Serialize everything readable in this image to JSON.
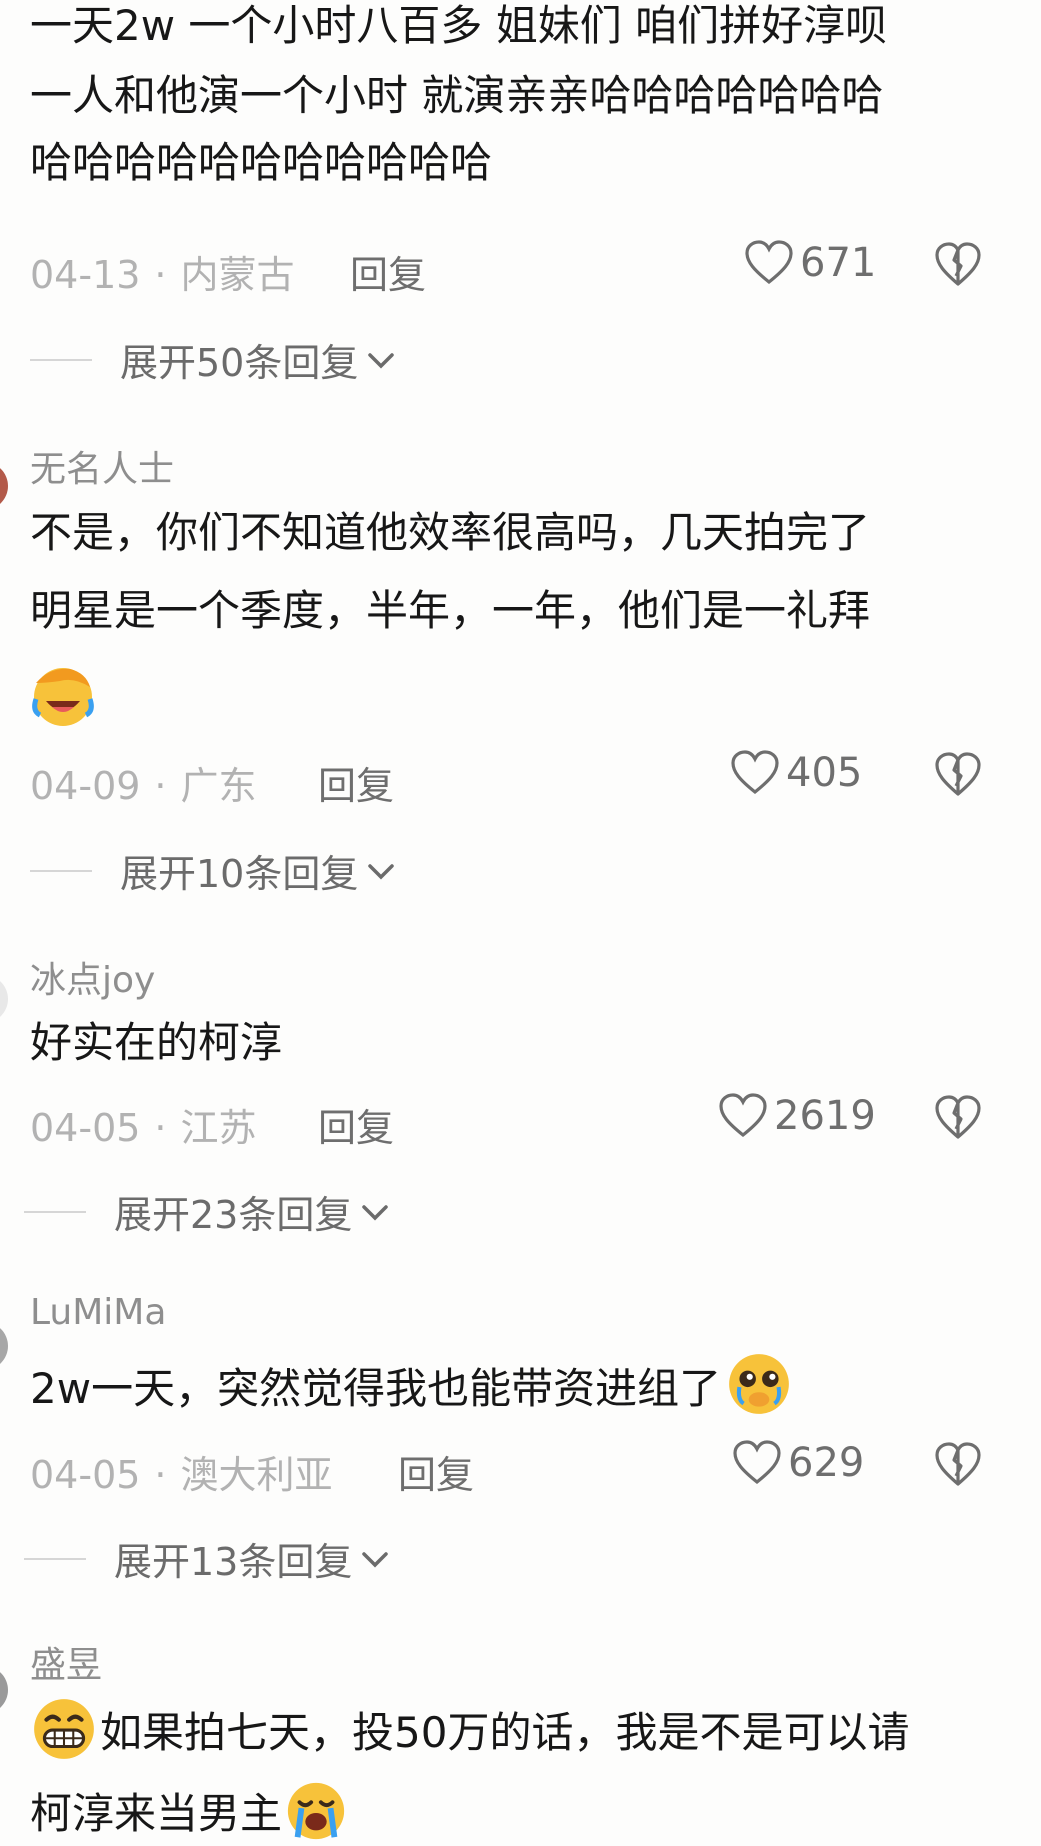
{
  "comments": [
    {
      "username": "",
      "lines": [
        "一天2w 一个小时八百多 姐妹们 咱们拼好淳呗",
        "一人和他演一个小时 就演亲亲哈哈哈哈哈哈哈",
        "哈哈哈哈哈哈哈哈哈哈哈"
      ],
      "date": "04-13",
      "location": "内蒙古",
      "reply_label": "回复",
      "likes": "671",
      "expand_label": "展开50条回复"
    },
    {
      "username": "无名人士",
      "lines": [
        "不是，你们不知道他效率很高吗，几天拍完了",
        "明星是一个季度，半年，一年，他们是一礼拜"
      ],
      "emoji_line": "laughing-crying-emoji",
      "date": "04-09",
      "location": "广东",
      "reply_label": "回复",
      "likes": "405",
      "expand_label": "展开10条回复"
    },
    {
      "username": "冰点joy",
      "lines": [
        "好实在的柯淳"
      ],
      "date": "04-05",
      "location": "江苏",
      "reply_label": "回复",
      "likes": "2619",
      "expand_label": "展开23条回复"
    },
    {
      "username": "LuMiMa",
      "lines": [
        "2w一天，突然觉得我也能带资进组了"
      ],
      "trailing_emoji": "teary-pleading-emoji",
      "date": "04-05",
      "location": "澳大利亚",
      "reply_label": "回复",
      "likes": "629",
      "expand_label": "展开13条回复"
    },
    {
      "username": "盛昱",
      "lines": [
        "如果拍七天，投50万的话，我是不是可以请",
        "柯淳来当男主"
      ],
      "leading_emoji": "grinning-emoji",
      "trailing_emoji": "crying-emoji"
    }
  ],
  "colors": {
    "background": "#fdfdfc",
    "text": "#171717",
    "muted": "#b2b2b2",
    "action": "#6e6e6e"
  }
}
